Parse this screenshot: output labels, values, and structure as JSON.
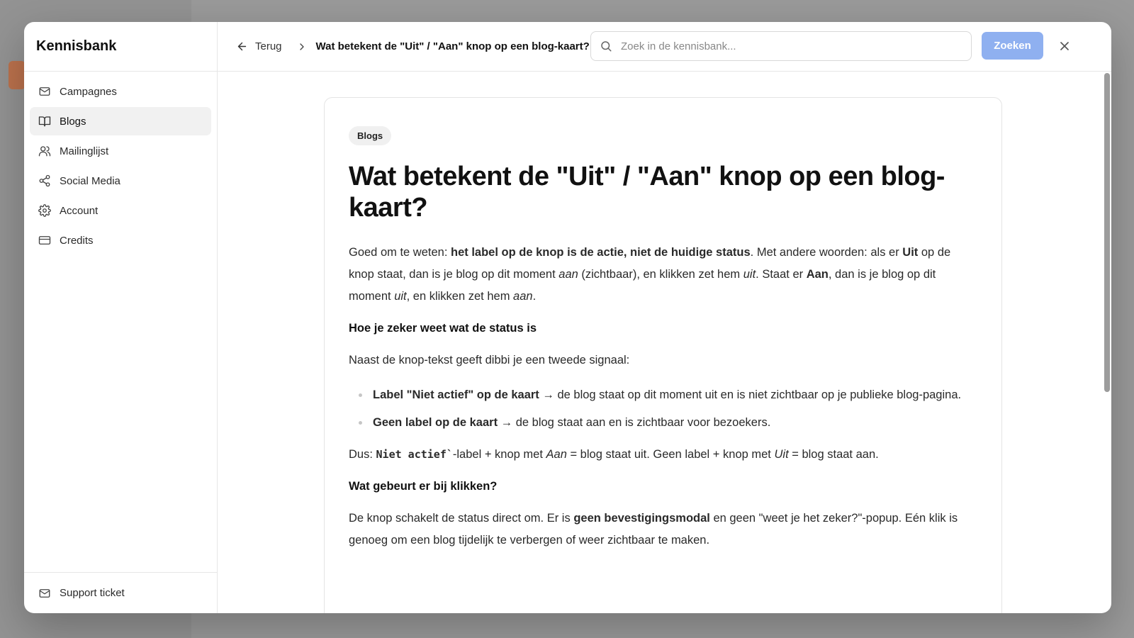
{
  "sidebar": {
    "title": "Kennisbank",
    "items": [
      {
        "label": "Campagnes",
        "icon": "mail-icon",
        "active": false
      },
      {
        "label": "Blogs",
        "icon": "book-icon",
        "active": true
      },
      {
        "label": "Mailinglijst",
        "icon": "users-icon",
        "active": false
      },
      {
        "label": "Social Media",
        "icon": "share-icon",
        "active": false
      },
      {
        "label": "Account",
        "icon": "gear-icon",
        "active": false
      },
      {
        "label": "Credits",
        "icon": "credit-card-icon",
        "active": false
      }
    ],
    "footer_label": "Support ticket"
  },
  "topbar": {
    "back_label": "Terug",
    "breadcrumb_title": "Wat betekent de \"Uit\" / \"Aan\" knop op een blog-kaart?",
    "search_placeholder": "Zoek in de kennisbank...",
    "search_value": "",
    "search_button": "Zoeken"
  },
  "article": {
    "tag": "Blogs",
    "title": "Wat betekent de \"Uit\" / \"Aan\" knop op een blog-kaart?",
    "p1": {
      "a": "Goed om te weten: ",
      "b": "het label op de knop is de actie, niet de huidige status",
      "c": ". Met andere woorden: als er ",
      "d": "Uit",
      "e": " op de knop staat, dan is je blog op dit moment ",
      "f": "aan",
      "g": " (zichtbaar), en klikken zet hem ",
      "h": "uit",
      "i": ". Staat er ",
      "j": "Aan",
      "k": ", dan is je blog op dit moment ",
      "l": "uit",
      "m": ", en klikken zet hem ",
      "n": "aan",
      "o": "."
    },
    "h_status": "Hoe je zeker weet wat de status is",
    "p2": "Naast de knop-tekst geeft dibbi je een tweede signaal:",
    "bullets": [
      {
        "bold": "Label \"Niet actief\" op de kaart",
        "rest": " → de blog staat op dit moment uit en is niet zichtbaar op je publieke blog-pagina."
      },
      {
        "bold": "Geen label op de kaart",
        "rest": " → de blog staat aan en is zichtbaar voor bezoekers."
      }
    ],
    "p3": {
      "a": "Dus: ",
      "code": "Niet actief`",
      "b": "-label + knop met ",
      "c": "Aan",
      "d": " = blog staat uit. Geen label + knop met ",
      "e": "Uit",
      "f": " = blog staat aan."
    },
    "h_click": "Wat gebeurt er bij klikken?",
    "p4": {
      "a": "De knop schakelt de status direct om. Er is ",
      "b": "geen bevestigingsmodal",
      "c": " en geen \"weet je het zeker?\"-popup. Eén klik is genoeg om een blog tijdelijk te verbergen of weer zichtbaar te maken."
    }
  }
}
